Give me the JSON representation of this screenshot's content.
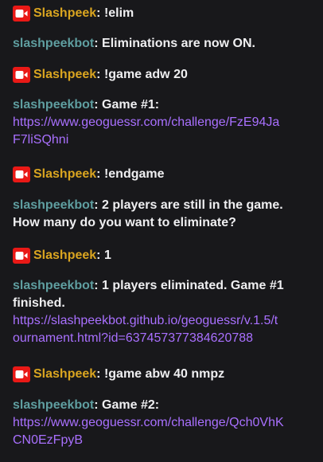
{
  "colors": {
    "background": "#18181b",
    "text": "#efeff1",
    "broadcaster_name": "#daa520",
    "bot_name": "#5f9ea0",
    "link": "#a970ff",
    "badge": "#e91916"
  },
  "broadcaster_badge_icon": "video-camera-icon",
  "messages": [
    {
      "user": "Slashpeek",
      "colon": ":",
      "text": "!elim"
    },
    {
      "user": "slashpeekbot",
      "colon": ":",
      "text": "Eliminations are now ON."
    },
    {
      "user": "Slashpeek",
      "colon": ":",
      "text": "!game adw 20"
    },
    {
      "user": "slashpeekbot",
      "colon": ":",
      "text": "Game #1:",
      "link_line1": "https://www.geoguessr.com/challenge/FzE94Ja",
      "link_line2": "F7liSQhni"
    },
    {
      "user": "Slashpeek",
      "colon": ":",
      "text": "!endgame"
    },
    {
      "user": "slashpeekbot",
      "colon": ":",
      "text": "2 players are still in the game.",
      "text_line2": "How many do you want to eliminate?"
    },
    {
      "user": "Slashpeek",
      "colon": ":",
      "text": "1"
    },
    {
      "user": "slashpeekbot",
      "colon": ":",
      "text": "1 players eliminated. Game #1",
      "text_line2": "finished.",
      "link_line1": "https://slashpeekbot.github.io/geoguessr/v.1.5/t",
      "link_line2": "ournament.html?id=637457377384620788"
    },
    {
      "user": "Slashpeek",
      "colon": ":",
      "text": "!game abw 40 nmpz"
    },
    {
      "user": "slashpeekbot",
      "colon": ":",
      "text": "Game #2:",
      "link_line1": "https://www.geoguessr.com/challenge/Qch0VhK",
      "link_line2": "CN0EzFpyB"
    }
  ]
}
